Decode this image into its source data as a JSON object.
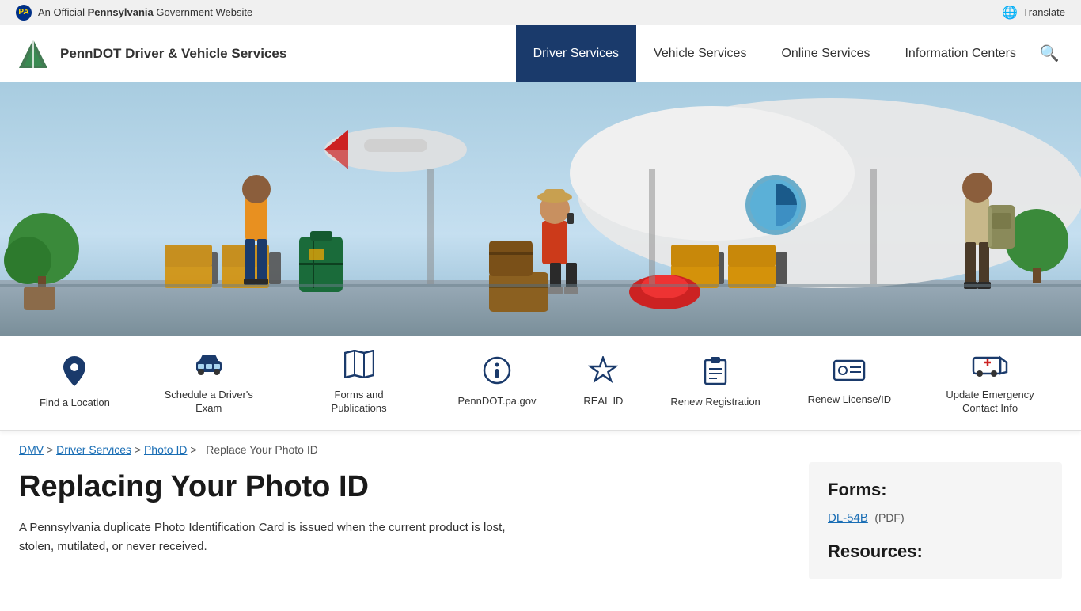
{
  "topbar": {
    "seal_label": "PA",
    "official_text": "An Official",
    "bold_text": "Pennsylvania",
    "gov_text": "Government Website",
    "translate_label": "Translate"
  },
  "nav": {
    "logo_text": "PennDOT Driver & Vehicle Services",
    "links": [
      {
        "id": "driver-services",
        "label": "Driver Services",
        "active": true
      },
      {
        "id": "vehicle-services",
        "label": "Vehicle Services",
        "active": false
      },
      {
        "id": "online-services",
        "label": "Online Services",
        "active": false
      },
      {
        "id": "information-centers",
        "label": "Information Centers",
        "active": false
      }
    ]
  },
  "quick_links": [
    {
      "id": "find-location",
      "label": "Find a Location",
      "icon": "📍"
    },
    {
      "id": "schedule-exam",
      "label": "Schedule a Driver's Exam",
      "icon": "🚗"
    },
    {
      "id": "forms-publications",
      "label": "Forms and Publications",
      "icon": "🗺"
    },
    {
      "id": "penndot-pagov",
      "label": "PennDOT.pa.gov",
      "icon": "ℹ"
    },
    {
      "id": "real-id",
      "label": "REAL ID",
      "icon": "⭐"
    },
    {
      "id": "renew-registration",
      "label": "Renew Registration",
      "icon": "📋"
    },
    {
      "id": "renew-license",
      "label": "Renew License/ID",
      "icon": "🪪"
    },
    {
      "id": "update-emergency",
      "label": "Update Emergency Contact Info",
      "icon": "🚑"
    }
  ],
  "breadcrumb": {
    "items": [
      {
        "label": "DMV",
        "link": true
      },
      {
        "label": "Driver Services",
        "link": true
      },
      {
        "label": "Photo ID",
        "link": true
      },
      {
        "label": "Replace Your Photo ID",
        "link": false
      }
    ]
  },
  "page": {
    "title": "Replacing Your Photo ID",
    "description": "A Pennsylvania duplicate Photo Identification Card is issued when the current product is lost, stolen, mutilated, or never received."
  },
  "sidebar": {
    "forms_title": "Forms:",
    "form_link_label": "DL-54B",
    "form_pdf_label": "(PDF)",
    "resources_title": "Resources:"
  }
}
